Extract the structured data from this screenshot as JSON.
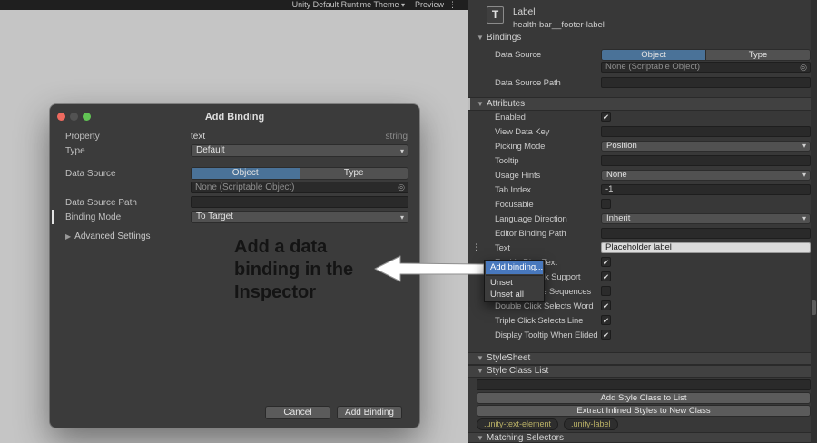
{
  "icons": {
    "caret_down": "▾",
    "kebab": "⋮",
    "target": "◎",
    "check": "✔",
    "foldout_open": "▼",
    "foldout_closed": "▶",
    "drag_handle": "⋮"
  },
  "colors": {
    "toggle_selected_blue": "#4A7298",
    "menu_highlight_blue": "#4878BD",
    "inspector_bg": "#383838",
    "canvas_bg": "#C5C5C5",
    "class_pill_text": "#B9B065"
  },
  "top_bar": {
    "theme": "Unity Default Runtime Theme",
    "preview": "Preview"
  },
  "dialog": {
    "title": "Add Binding",
    "property": {
      "label": "Property",
      "value": "text",
      "type": "string"
    },
    "type": {
      "label": "Type",
      "value": "Default"
    },
    "data_source": {
      "label": "Data Source",
      "object_tab": "Object",
      "type_tab": "Type",
      "value": "None (Scriptable Object)"
    },
    "data_source_path": {
      "label": "Data Source Path",
      "value": ""
    },
    "binding_mode": {
      "label": "Binding Mode",
      "value": "To Target"
    },
    "advanced_settings": "Advanced Settings",
    "cancel": "Cancel",
    "submit": "Add Binding"
  },
  "annotation": {
    "lines": [
      "Add a data",
      "binding in the",
      "Inspector"
    ]
  },
  "inspector": {
    "header": {
      "icon": "T",
      "type": "Label",
      "name": "health-bar__footer-label"
    },
    "bindings": {
      "title": "Bindings",
      "data_source": {
        "label": "Data Source",
        "object_tab": "Object",
        "type_tab": "Type",
        "value": "None (Scriptable Object)"
      },
      "data_source_path": {
        "label": "Data Source Path",
        "value": ""
      }
    },
    "attributes": {
      "title": "Attributes",
      "rows": [
        {
          "label": "Enabled",
          "type": "checkbox",
          "checked": true
        },
        {
          "label": "View Data Key",
          "type": "field",
          "value": ""
        },
        {
          "label": "Picking Mode",
          "type": "dropdown",
          "value": "Position"
        },
        {
          "label": "Tooltip",
          "type": "field",
          "value": ""
        },
        {
          "label": "Usage Hints",
          "type": "dropdown",
          "value": "None"
        },
        {
          "label": "Tab Index",
          "type": "field",
          "value": "-1"
        },
        {
          "label": "Focusable",
          "type": "checkbox",
          "checked": false
        },
        {
          "label": "Language Direction",
          "type": "dropdown",
          "value": "Inherit"
        },
        {
          "label": "Editor Binding Path",
          "type": "field",
          "value": ""
        },
        {
          "label": "Text",
          "type": "field",
          "value": "Placeholder label"
        },
        {
          "label": "Enable Rich Text",
          "type": "checkbox",
          "checked": true
        },
        {
          "label": "Emoji Fallback Support",
          "type": "checkbox",
          "checked": true
        },
        {
          "label": "Parse Escape Sequences",
          "type": "checkbox",
          "checked": false
        },
        {
          "label": "Double Click Selects Word",
          "type": "checkbox",
          "checked": true
        },
        {
          "label": "Triple Click Selects Line",
          "type": "checkbox",
          "checked": true
        },
        {
          "label": "Display Tooltip When Elided",
          "type": "checkbox",
          "checked": true
        }
      ]
    },
    "stylesheet": {
      "title": "StyleSheet"
    },
    "style_class_list": {
      "title": "Style Class List",
      "field_value": "",
      "add_button": "Add Style Class to List",
      "extract_button": "Extract Inlined Styles to New Class",
      "classes": [
        ".unity-text-element",
        ".unity-label"
      ]
    },
    "matching_selectors": {
      "title": "Matching Selectors"
    }
  },
  "context_menu": {
    "items": [
      "Add binding...",
      "Unset",
      "Unset all"
    ],
    "highlighted_index": 0
  }
}
